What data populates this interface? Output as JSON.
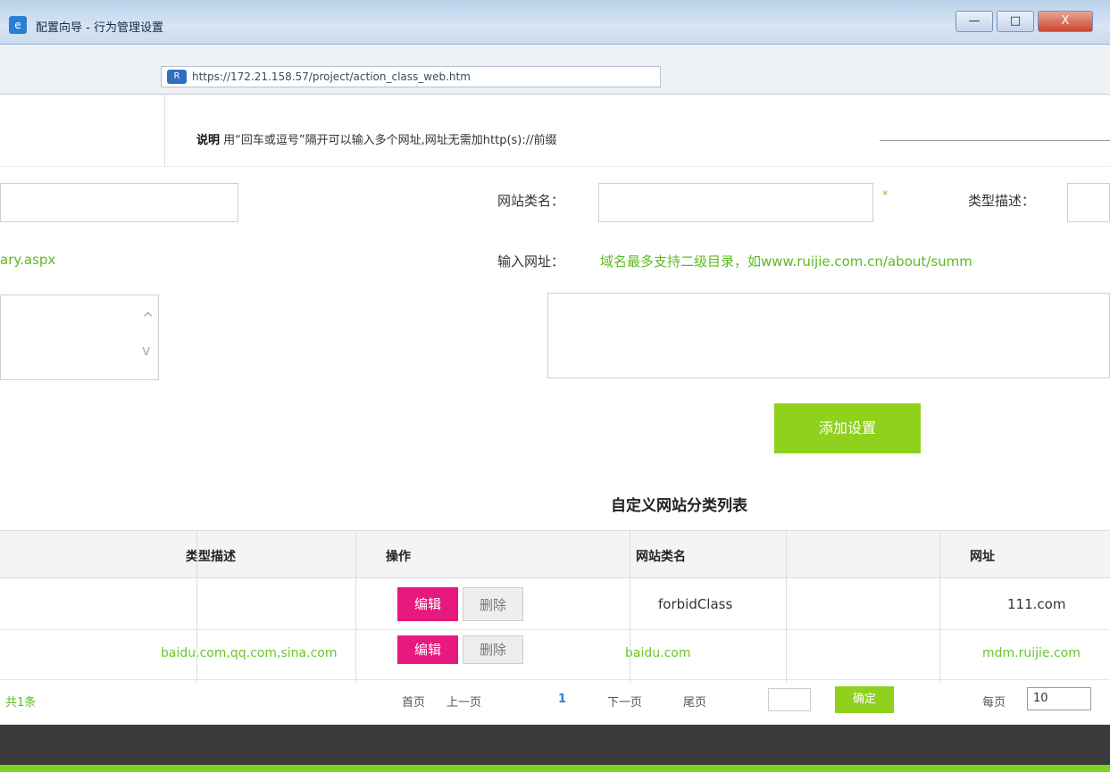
{
  "window": {
    "title": "配置向导 - 行为管理设置",
    "min_label": "—",
    "max_label": "□",
    "close_label": "X",
    "icon_glyph": "e",
    "url_icon_glyph": "R",
    "url": "https://172.21.158.57/project/action_class_web.htm"
  },
  "note": {
    "label": "说明",
    "text": "用“回车或逗号”隔开可以输入多个网址,网址无需加http(s)://前缀"
  },
  "form": {
    "class_name_label": "网站类名：",
    "class_name_value": "",
    "required_mark": "*",
    "desc_label": "类型描述：",
    "desc_value": "",
    "url_label": "输入网址：",
    "url_hint": "域名最多支持二级目录，如www.ruijie.com.cn/about/summ",
    "left_path_fragment": "ary.aspx",
    "urls_value": "",
    "add_button": "添加设置",
    "scroll_up_glyph": "^",
    "scroll_down_glyph": "v"
  },
  "list": {
    "title": "自定义网站分类列表",
    "headers": [
      "类型描述",
      "操作",
      "网站类名",
      "网址"
    ],
    "rows": [
      {
        "edit": "编辑",
        "delete": "删除",
        "class_name": "forbidClass",
        "url": "111.com"
      },
      {
        "edit": "编辑",
        "delete": "删除",
        "left_link": "baidu.com,qq.com,sina.com",
        "mid_link": "baidu.com",
        "right_link": "mdm.ruijie.com"
      }
    ]
  },
  "pager": {
    "left_text": "共1条",
    "first": "首页",
    "prev": "上一页",
    "current_page": "1",
    "next": "下一页",
    "last": "尾页",
    "go_button": "确定",
    "page_size_label": "每页",
    "page_size_value": "10"
  },
  "colors": {
    "accent_green": "#8fd11c",
    "edit_magenta": "#e6197f"
  }
}
